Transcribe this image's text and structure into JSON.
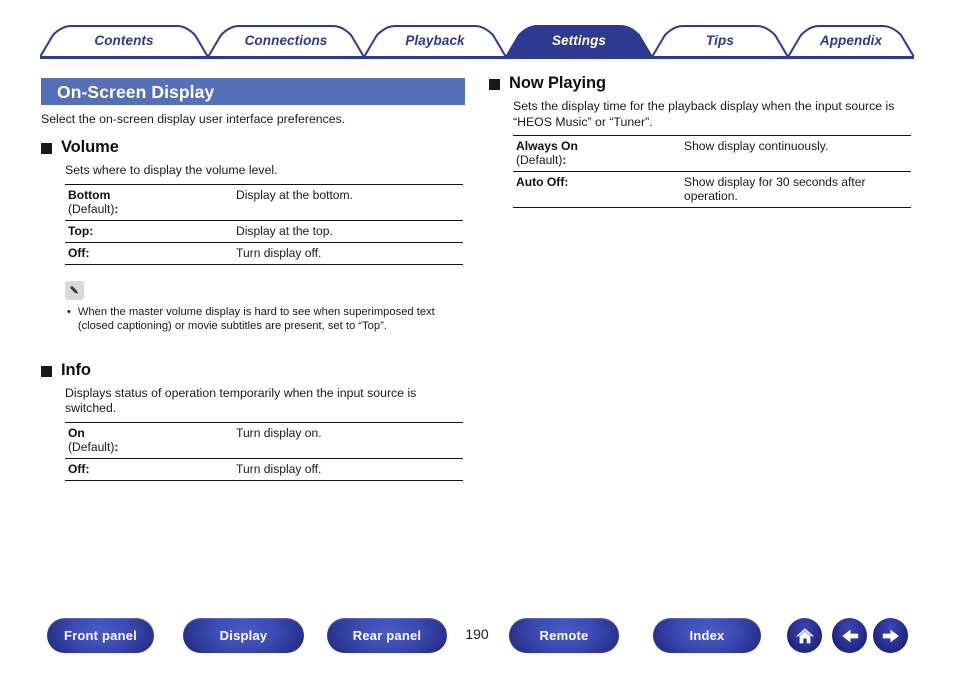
{
  "tabs": [
    {
      "label": "Contents",
      "active": false
    },
    {
      "label": "Connections",
      "active": false
    },
    {
      "label": "Playback",
      "active": false
    },
    {
      "label": "Settings",
      "active": true
    },
    {
      "label": "Tips",
      "active": false
    },
    {
      "label": "Appendix",
      "active": false
    }
  ],
  "page": {
    "title": "On-Screen Display",
    "subtitle": "Select the on-screen display user interface preferences.",
    "number": "190"
  },
  "left_sections": [
    {
      "title": "Volume",
      "description": "Sets where to display the volume level.",
      "rows": [
        {
          "name": "Bottom",
          "default_label": "(Default)",
          "colon": ":",
          "value": "Display at the bottom."
        },
        {
          "name": "Top:",
          "default_label": "",
          "colon": "",
          "value": "Display at the top."
        },
        {
          "name": "Off:",
          "default_label": "",
          "colon": "",
          "value": "Turn display off."
        }
      ]
    },
    {
      "title": "Info",
      "description": "Displays status of operation temporarily when the input source is switched.",
      "rows": [
        {
          "name": "On",
          "default_label": "(Default)",
          "colon": ":",
          "value": "Turn display on."
        },
        {
          "name": "Off:",
          "default_label": "",
          "colon": "",
          "value": "Turn display off."
        }
      ]
    }
  ],
  "note": {
    "icon": "pencil-icon",
    "bullet": "•",
    "text": "When the master volume display is hard to see when superimposed text (closed captioning) or movie subtitles are present, set to “Top”."
  },
  "right_sections": [
    {
      "title": "Now Playing",
      "description": "Sets the display time for the playback display when the input source is “HEOS Music” or “Tuner”.",
      "rows": [
        {
          "name": "Always On",
          "default_label": "(Default)",
          "colon": ":",
          "value": "Show display continuously."
        },
        {
          "name": "Auto Off:",
          "default_label": "",
          "colon": "",
          "value": "Show display for 30 seconds after operation."
        }
      ]
    }
  ],
  "footer": {
    "buttons": [
      {
        "label": "Front panel",
        "name": "front-panel-button"
      },
      {
        "label": "Display",
        "name": "display-button"
      },
      {
        "label": "Rear panel",
        "name": "rear-panel-button"
      },
      {
        "label": "Remote",
        "name": "remote-button"
      },
      {
        "label": "Index",
        "name": "index-button"
      }
    ],
    "icons": [
      {
        "name": "home-icon"
      },
      {
        "name": "arrow-left-icon"
      },
      {
        "name": "arrow-right-icon"
      }
    ]
  },
  "colors": {
    "tab_blue": "#2e3a92",
    "title_bar_blue": "#5670b8",
    "button_blue": "#27318c",
    "note_icon_bg": "#d9d9d9"
  }
}
